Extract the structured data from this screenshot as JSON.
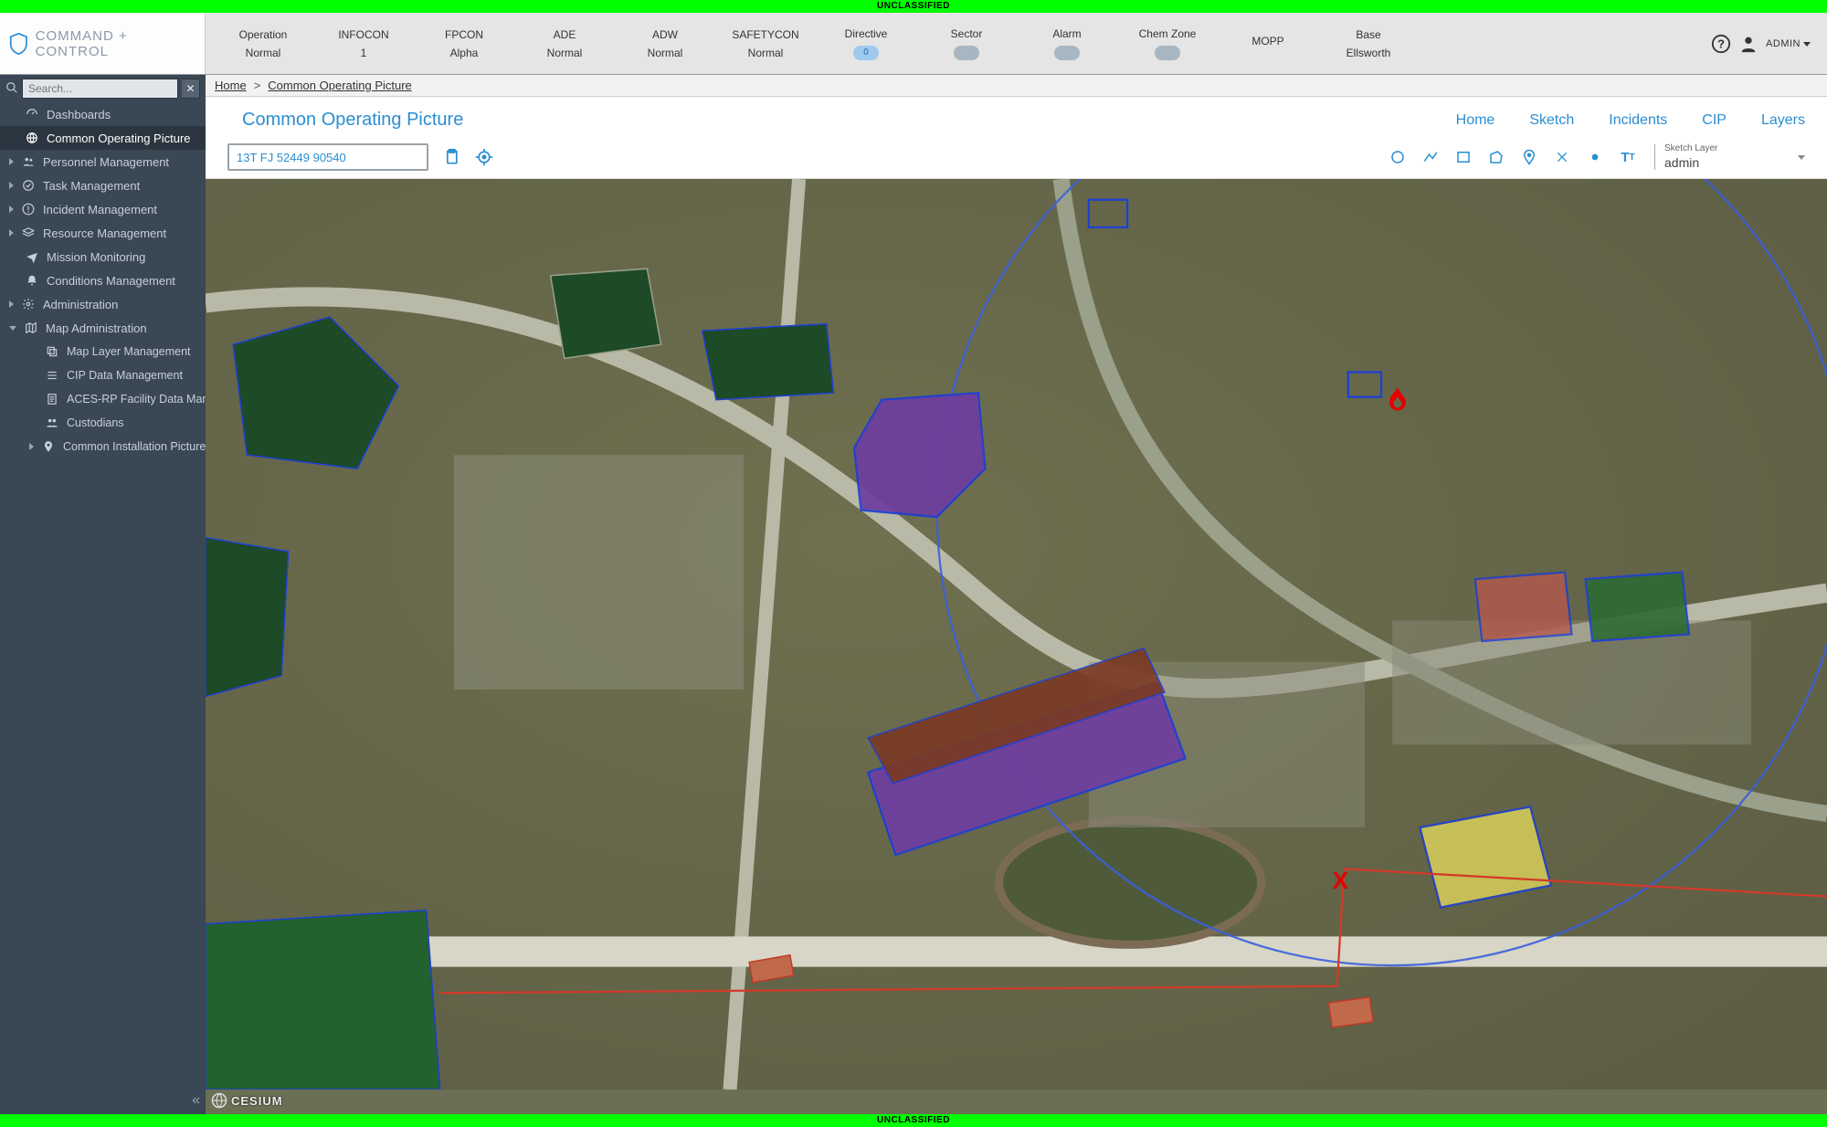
{
  "classification": "UNCLASSIFIED",
  "brand": "COMMAND + CONTROL",
  "status": [
    {
      "label": "Operation",
      "value": "Normal",
      "type": "text"
    },
    {
      "label": "INFOCON",
      "value": "1",
      "type": "text"
    },
    {
      "label": "FPCON",
      "value": "Alpha",
      "type": "text"
    },
    {
      "label": "ADE",
      "value": "Normal",
      "type": "text"
    },
    {
      "label": "ADW",
      "value": "Normal",
      "type": "text"
    },
    {
      "label": "SAFETYCON",
      "value": "Normal",
      "type": "text"
    },
    {
      "label": "Directive",
      "value": "0",
      "type": "badge-blue"
    },
    {
      "label": "Sector",
      "value": "",
      "type": "badge"
    },
    {
      "label": "Alarm",
      "value": "",
      "type": "badge"
    },
    {
      "label": "Chem Zone",
      "value": "",
      "type": "badge"
    },
    {
      "label": "MOPP",
      "value": "",
      "type": "text"
    },
    {
      "label": "Base",
      "value": "Ellsworth",
      "type": "text"
    }
  ],
  "user": {
    "name": "ADMIN"
  },
  "sidebar": {
    "search_placeholder": "Search...",
    "items": [
      {
        "label": "Dashboards",
        "icon": "gauge"
      },
      {
        "label": "Common Operating Picture",
        "icon": "globe",
        "active": true
      },
      {
        "label": "Personnel Management",
        "icon": "users",
        "caret": true
      },
      {
        "label": "Task Management",
        "icon": "check-circle",
        "caret": true
      },
      {
        "label": "Incident Management",
        "icon": "exclaim",
        "caret": true
      },
      {
        "label": "Resource Management",
        "icon": "stack",
        "caret": true
      },
      {
        "label": "Mission Monitoring",
        "icon": "plane"
      },
      {
        "label": "Conditions Management",
        "icon": "bell"
      },
      {
        "label": "Administration",
        "icon": "gear",
        "caret": true
      },
      {
        "label": "Map Administration",
        "icon": "map",
        "caret": true,
        "expanded": true
      }
    ],
    "map_admin_children": [
      {
        "label": "Map Layer Management",
        "icon": "copy"
      },
      {
        "label": "CIP Data Management",
        "icon": "list"
      },
      {
        "label": "ACES-RP Facility Data Management",
        "icon": "sheet"
      },
      {
        "label": "Custodians",
        "icon": "people"
      },
      {
        "label": "Common Installation Picture",
        "icon": "pin",
        "caret": true
      }
    ]
  },
  "breadcrumb": {
    "home": "Home",
    "current": "Common Operating Picture"
  },
  "panel": {
    "title": "Common Operating Picture",
    "tabs": [
      "Home",
      "Sketch",
      "Incidents",
      "CIP",
      "Layers"
    ]
  },
  "toolbar": {
    "coord_value": "13T FJ 52449 90540",
    "sketch_layer_label": "Sketch Layer",
    "sketch_layer_value": "admin"
  },
  "map": {
    "engine_badge": "CESIUM",
    "overlays": {
      "fire_marker": true,
      "red_x_marker": true
    },
    "highlight_colors": {
      "purple": "#6e3ea0",
      "yellow": "#d9cf5a",
      "dark_green": "#1d4a27",
      "red_tint": "#b5594d",
      "outline_blue": "#1d3fd4"
    }
  }
}
